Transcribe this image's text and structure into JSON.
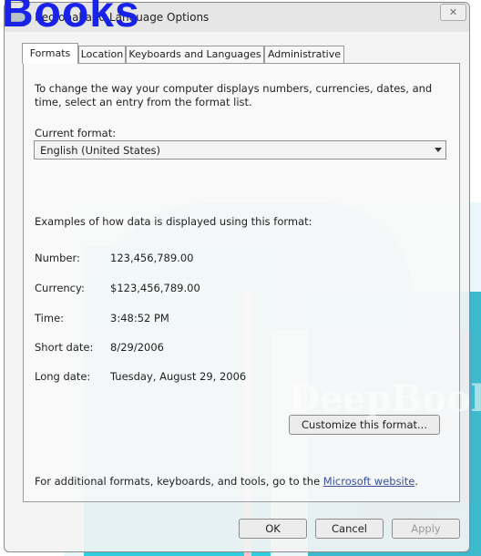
{
  "window": {
    "title": "Regional and Language Options",
    "close_glyph": "✕"
  },
  "tabs": [
    {
      "label": "Formats",
      "selected": true
    },
    {
      "label": "Location",
      "selected": false
    },
    {
      "label": "Keyboards and Languages",
      "selected": false
    },
    {
      "label": "Administrative",
      "selected": false
    }
  ],
  "formats": {
    "intro_line1": "To change the way your computer displays numbers, currencies, dates, and",
    "intro_line2": "time, select an entry from the format list.",
    "current_format_label": "Current format:",
    "current_format_value": "English (United States)",
    "examples_heading": "Examples of how data is displayed using this format:",
    "examples": [
      {
        "label": "Number:",
        "value": "123,456,789.00"
      },
      {
        "label": "Currency:",
        "value": "$123,456,789.00"
      },
      {
        "label": "Time:",
        "value": "3:48:52 PM"
      },
      {
        "label": "Short date:",
        "value": "8/29/2006"
      },
      {
        "label": "Long date:",
        "value": "Tuesday, August 29, 2006"
      }
    ],
    "customize_button": "Customize this format...",
    "footer_text": "For additional formats, keyboards, and tools, go to the",
    "footer_link": "Microsoft website",
    "footer_period": "."
  },
  "buttons": {
    "ok": "OK",
    "cancel": "Cancel",
    "apply": "Apply"
  },
  "watermark": {
    "top_text": "Books",
    "lower_text": "DeepBook"
  },
  "colors": {
    "watermark_blue": "#1822e8",
    "link": "#3a4f9a"
  }
}
